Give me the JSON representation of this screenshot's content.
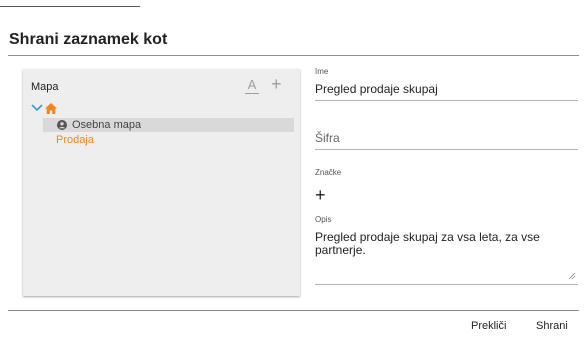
{
  "dialog": {
    "title": "Shrani zaznamek kot"
  },
  "folder_panel": {
    "label": "Mapa",
    "font_tool_glyph": "A",
    "add_tool_glyph": "+",
    "icons": {
      "expand": "chevron-down-icon",
      "root": "home-icon",
      "personal": "user-circle-icon",
      "font_tool": "text-format-icon",
      "add_tool": "plus-icon"
    },
    "colors": {
      "accent": "#f0851c",
      "chevron": "#3a98d8"
    },
    "tree": {
      "selected_item": "Osebna mapa",
      "child_item": "Prodaja"
    }
  },
  "form": {
    "name_label": "Ime",
    "name_value": "Pregled prodaje skupaj",
    "code_placeholder": "Šifra",
    "tags_label": "Značke",
    "tags_add_glyph": "+",
    "description_label": "Opis",
    "description_value": "Pregled prodaje skupaj za vsa leta, za vse partnerje."
  },
  "footer": {
    "cancel_label": "Prekliči",
    "save_label": "Shrani"
  }
}
